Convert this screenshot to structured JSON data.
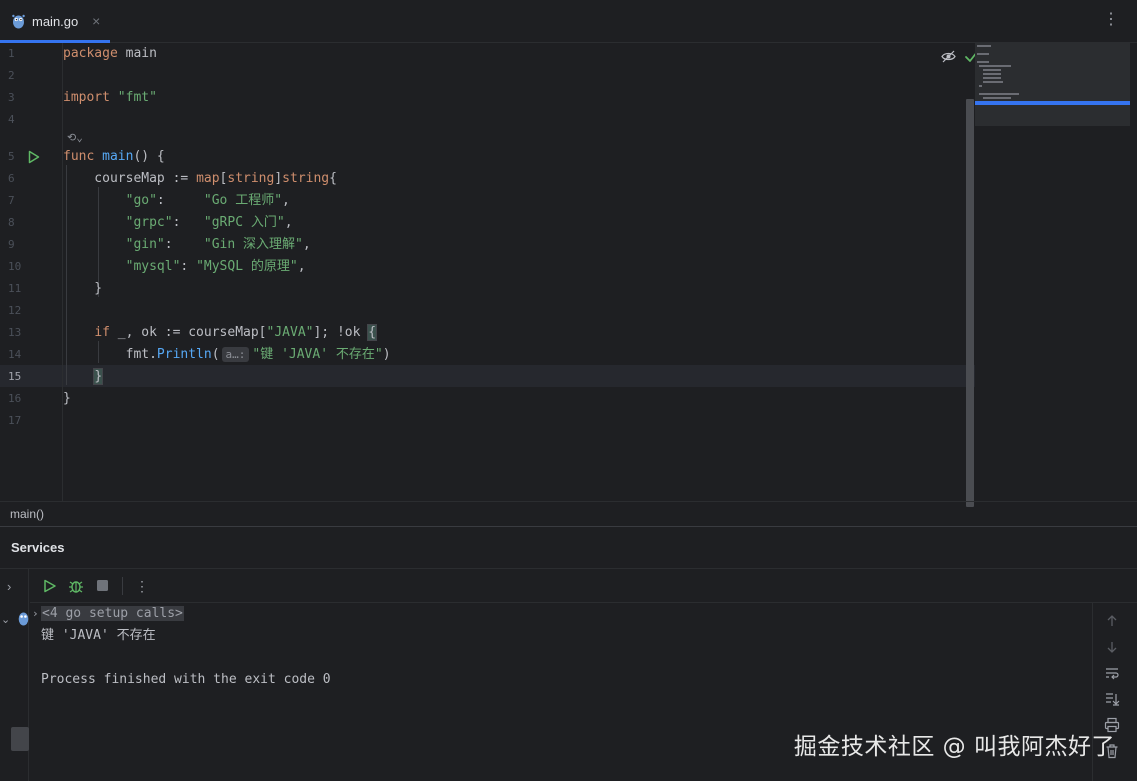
{
  "tab": {
    "filename": "main.go",
    "close_glyph": "×",
    "menu_glyph": "⋮"
  },
  "editor": {
    "line_numbers": [
      "1",
      "2",
      "3",
      "4",
      "5",
      "6",
      "7",
      "8",
      "9",
      "10",
      "11",
      "12",
      "13",
      "14",
      "15",
      "16",
      "17"
    ],
    "active_line": "15",
    "code": {
      "l1_kw": "package",
      "l1_name": " main",
      "l3_kw": "import",
      "l3_str": " \"fmt\"",
      "l5_kw": "func",
      "l5_fn": "main",
      "l5_rest": "() {",
      "l6_a": "    courseMap := ",
      "l6_kw1": "map",
      "l6_b": "[",
      "l6_kw2": "string",
      "l6_c": "]",
      "l6_kw3": "string",
      "l6_d": "{",
      "l7_key": "        \"go\"",
      "l7_sep": ":     ",
      "l7_val": "\"Go 工程师\"",
      "l7_end": ",",
      "l8_key": "        \"grpc\"",
      "l8_sep": ":   ",
      "l8_val": "\"gRPC 入门\"",
      "l8_end": ",",
      "l9_key": "        \"gin\"",
      "l9_sep": ":    ",
      "l9_val": "\"Gin 深入理解\"",
      "l9_end": ",",
      "l10_key": "        \"mysql\"",
      "l10_sep": ": ",
      "l10_val": "\"MySQL 的原理\"",
      "l10_end": ",",
      "l11": "    }",
      "l13_a": "    ",
      "l13_kw": "if",
      "l13_b": " _, ok := courseMap[",
      "l13_str": "\"JAVA\"",
      "l13_c": "]; !ok ",
      "l13_brace": "{",
      "l14_a": "        fmt.",
      "l14_fn": "Println",
      "l14_b": "(",
      "l14_inlay": "a…:",
      "l14_str": "\"键 'JAVA' 不存在\"",
      "l14_c": ")",
      "l15_a": "    ",
      "l15_brace": "}",
      "l16": "}"
    },
    "inlay_icon_glyph": "⟲⌄"
  },
  "breadcrumb": {
    "label": "main()"
  },
  "services": {
    "title": "Services",
    "expand_glyph": "›",
    "collapse_glyph": "⌄",
    "toolbar_menu_glyph": "⋮",
    "console": {
      "fold_glyph": "›",
      "setup_calls": "<4 go setup calls>",
      "output_line": "键 'JAVA' 不存在",
      "process_line": "Process finished with the exit code 0"
    }
  },
  "watermark": "掘金技术社区 @ 叫我阿杰好了",
  "colors": {
    "keyword": "#cf8e6d",
    "function": "#56a8f5",
    "string": "#6aab73",
    "accent": "#3574f0",
    "run_green": "#5fb865"
  }
}
